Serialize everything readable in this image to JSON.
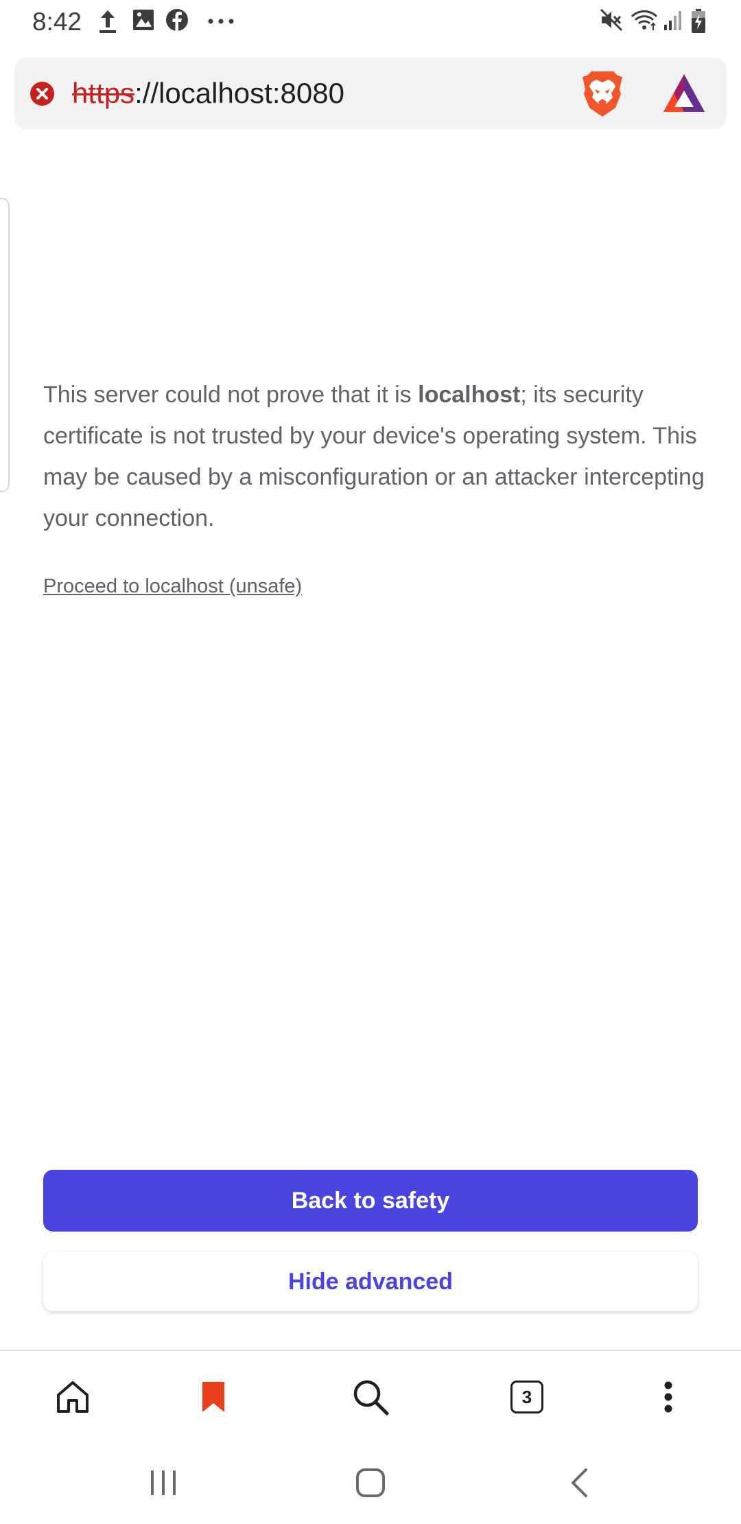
{
  "status_bar": {
    "time": "8:42",
    "left_icons": [
      "upload-icon",
      "image-icon",
      "facebook-icon",
      "more-dots-icon"
    ],
    "right_icons": [
      "mute-icon",
      "wifi-icon",
      "signal-icon",
      "battery-icon"
    ]
  },
  "address_bar": {
    "scheme": "https",
    "rest": "://localhost:8080",
    "security_icon": "not-secure-icon",
    "brand_icons": [
      "brave-lion-icon",
      "bat-rewards-icon"
    ]
  },
  "interstitial": {
    "explanation_before": "This server could not prove that it is ",
    "host": "localhost",
    "explanation_after": "; its security certificate is not trusted by your device's operating system. This may be caused by a misconfiguration or an attacker intercepting your connection.",
    "proceed_link": "Proceed to localhost (unsafe)",
    "primary_button": "Back to safety",
    "secondary_button": "Hide advanced"
  },
  "toolbar": {
    "items": [
      "home-icon",
      "bookmark-icon",
      "search-icon",
      "tabs-icon",
      "menu-icon"
    ],
    "tab_count": "3"
  },
  "nav_bar": {
    "items": [
      "recents-icon",
      "home-button-icon",
      "back-icon"
    ]
  },
  "colors": {
    "accent": "#4a44e0",
    "error": "#c5221f",
    "brave_orange": "#f1562b",
    "bookmark_active": "#e8401c"
  }
}
